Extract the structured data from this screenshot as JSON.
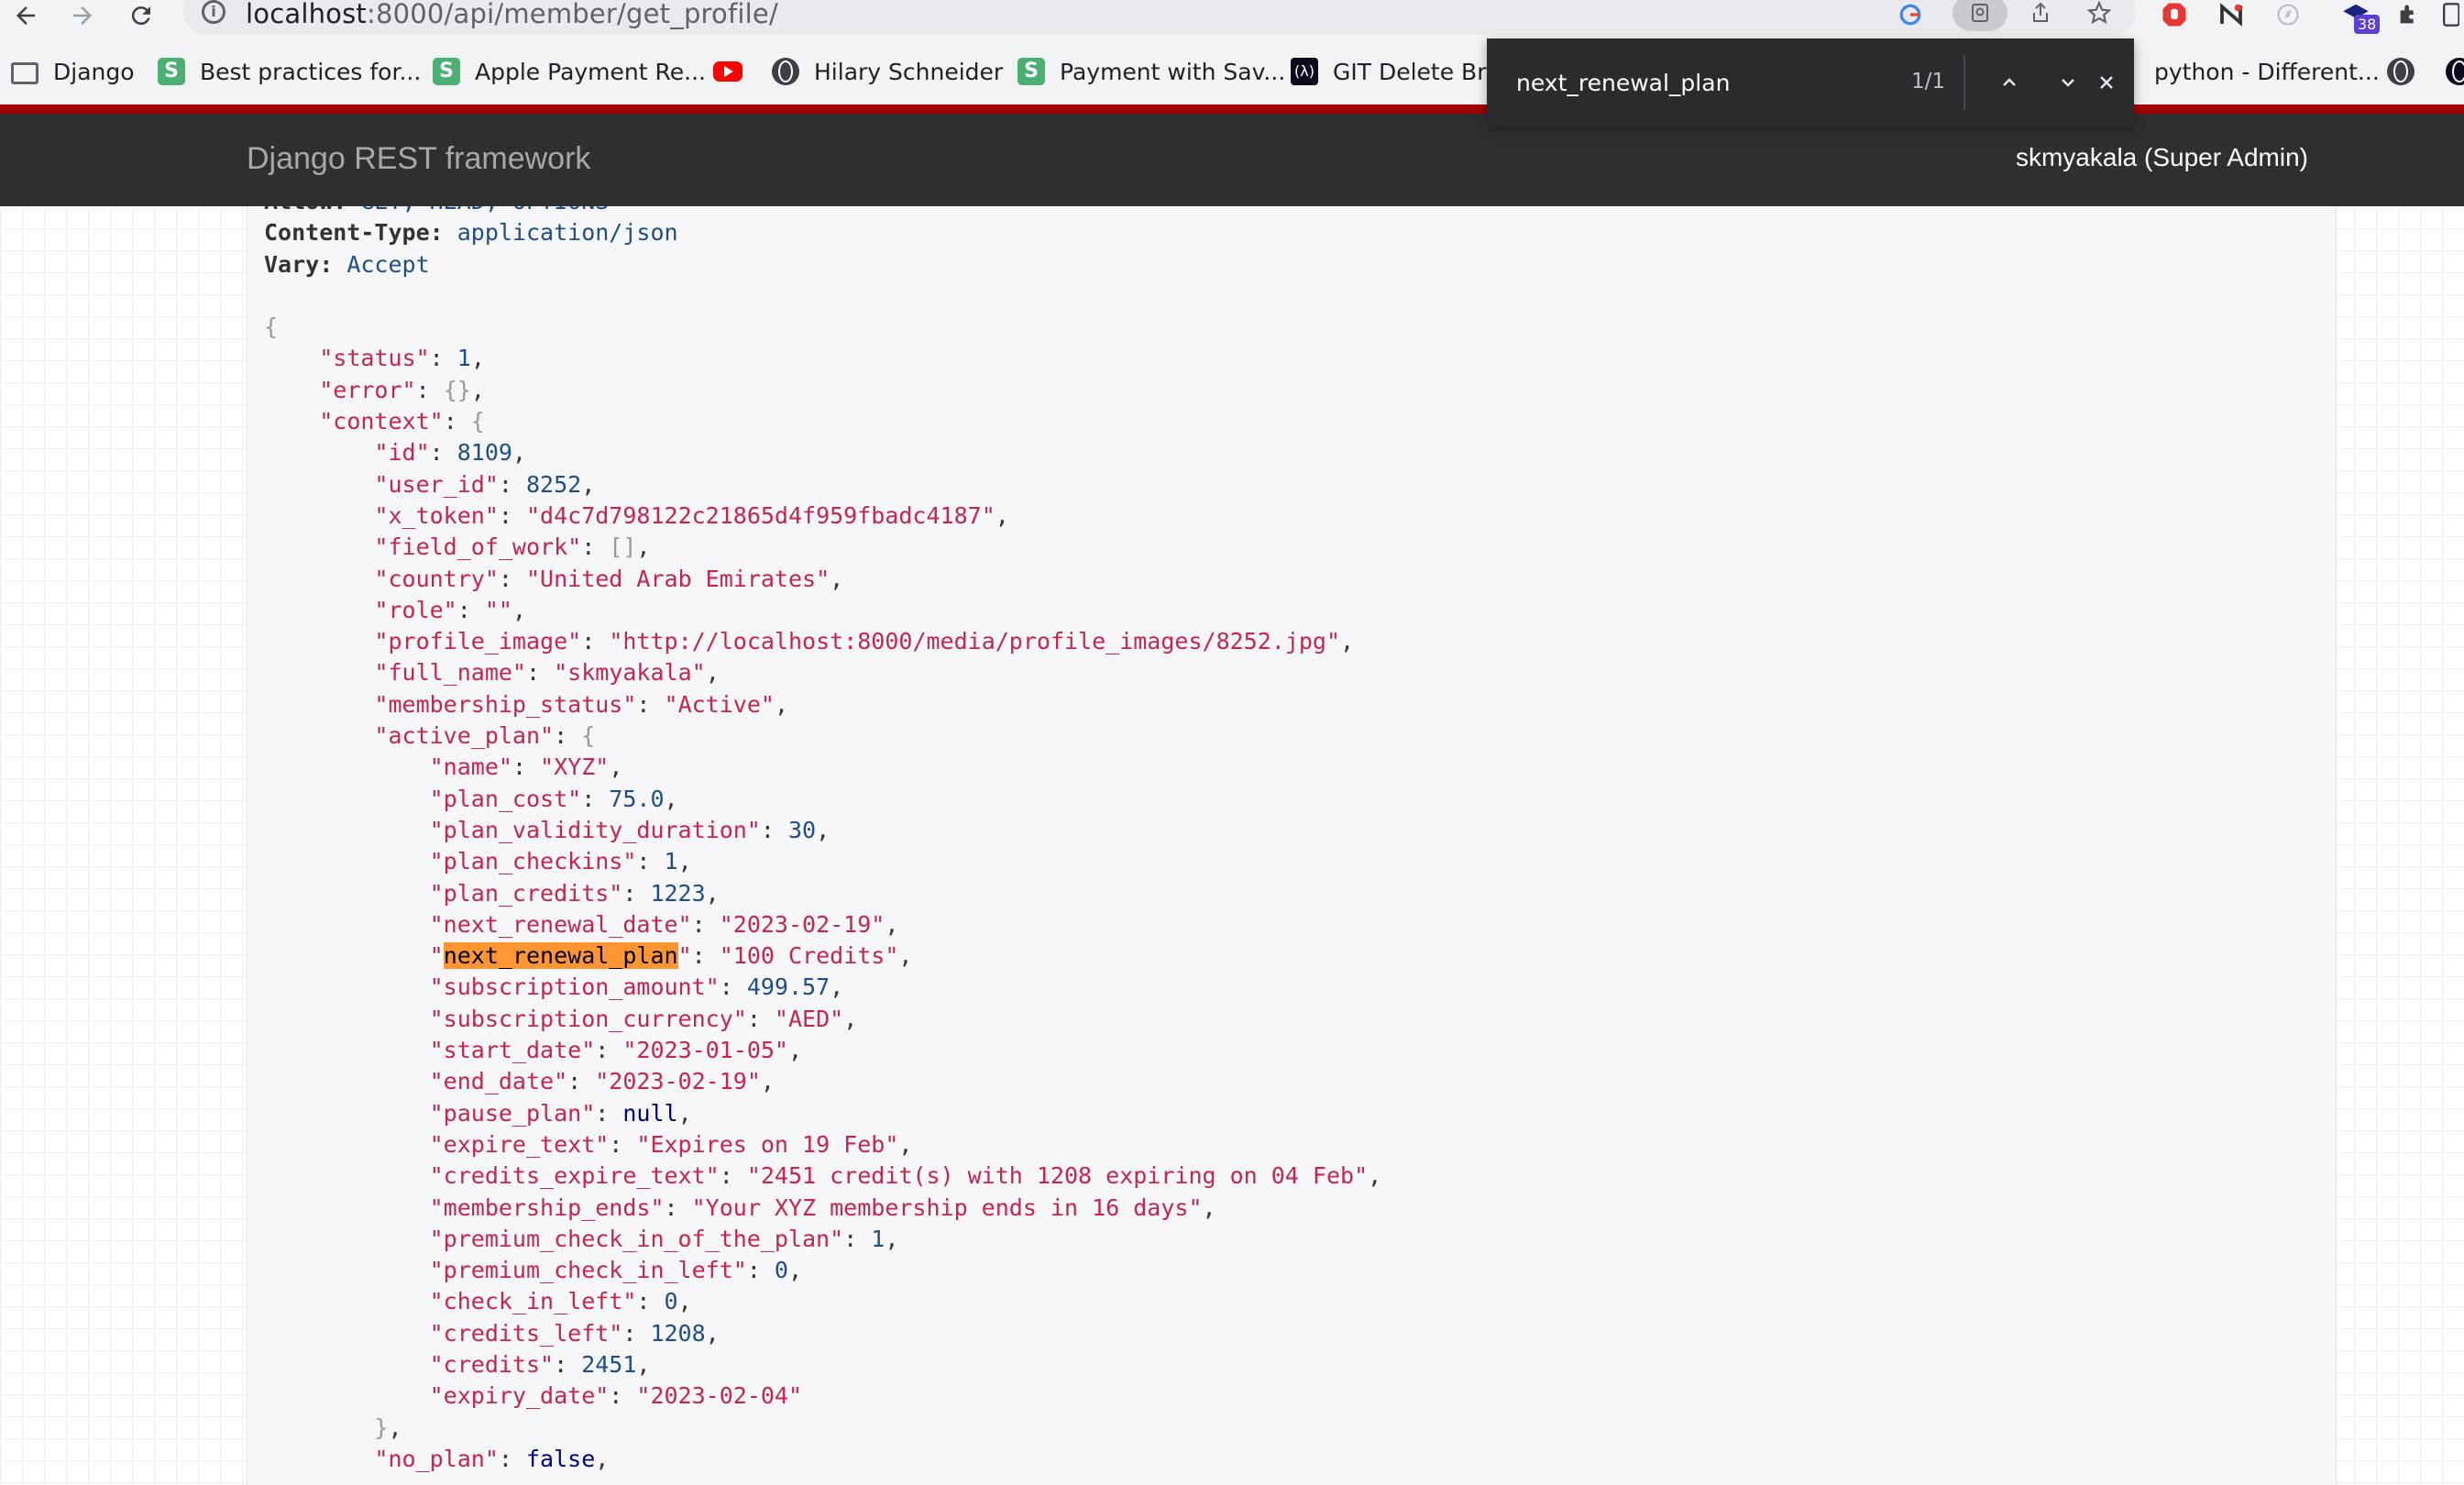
{
  "browser": {
    "url_host": "localhost",
    "url_rest": ":8000/api/member/get_profile/",
    "extension_badge": "38"
  },
  "bookmarks": [
    {
      "label": "Django",
      "icon": "folder-icon"
    },
    {
      "label": "Best practices for...",
      "icon": "s-icon"
    },
    {
      "label": "Apple Payment Re...",
      "icon": "s-icon"
    },
    {
      "label": "",
      "icon": "youtube-icon"
    },
    {
      "label": "Hilary Schneider",
      "icon": "globe-icon"
    },
    {
      "label": "Payment with Sav...",
      "icon": "s-icon"
    },
    {
      "label": "GIT Delete Bra",
      "icon": "git-icon"
    },
    {
      "label": "python - Different...",
      "icon": "globe-icon"
    }
  ],
  "find": {
    "query": "next_renewal_plan",
    "count": "1/1"
  },
  "navbar": {
    "brand": "Django REST framework",
    "user": "skmyakala (Super Admin)"
  },
  "headers": [
    {
      "name": "Allow:",
      "value": "GET, HEAD, OPTIONS"
    },
    {
      "name": "Content-Type:",
      "value": "application/json"
    },
    {
      "name": "Vary:",
      "value": "Accept"
    }
  ],
  "response": {
    "status": "1",
    "id": "8109",
    "user_id": "8252",
    "x_token": "\"d4c7d798122c21865d4f959fbadc4187\"",
    "country": "\"United Arab Emirates\"",
    "role": "\"\"",
    "profile_image": "\"http://localhost:8000/media/profile_images/8252.jpg\"",
    "full_name": "\"skmyakala\"",
    "membership_status": "\"Active\"",
    "plan_name": "\"XYZ\"",
    "plan_cost": "75.0",
    "plan_validity_duration": "30",
    "plan_checkins": "1",
    "plan_credits": "1223",
    "next_renewal_date": "\"2023-02-19\"",
    "next_renewal_plan": "\"100 Credits\"",
    "subscription_amount": "499.57",
    "subscription_currency": "\"AED\"",
    "start_date": "\"2023-01-05\"",
    "end_date": "\"2023-02-19\"",
    "pause_plan": "null",
    "expire_text": "\"Expires on 19 Feb\"",
    "credits_expire_text": "\"2451 credit(s) with 1208 expiring on 04 Feb\"",
    "membership_ends": "\"Your XYZ membership ends in 16 days\"",
    "premium_check_in_of_the_plan": "1",
    "premium_check_in_left": "0",
    "check_in_left": "0",
    "credits_left": "1208",
    "credits": "2451",
    "expiry_date": "\"2023-02-04\"",
    "no_plan": "false"
  },
  "colors": {
    "accent_red": "#a30000",
    "navbar": "#2f2f2f",
    "find_highlight": "#ff9632"
  }
}
